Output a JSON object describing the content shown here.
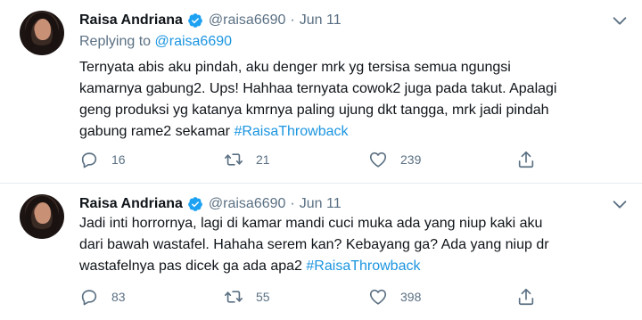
{
  "tweets": [
    {
      "name": "Raisa Andriana",
      "handle": "@raisa6690",
      "separator": "·",
      "time": "Jun 11",
      "replying_prefix": "Replying to",
      "replying_to": "@raisa6690",
      "text_lines": [
        "Ternyata abis aku pindah, aku denger mrk yg tersisa semua ngungsi",
        "kamarnya gabung2. Ups! Hahhaa ternyata cowok2 juga pada takut. Apalagi",
        "geng produksi yg katanya kmrnya paling ujung dkt tangga, mrk jadi pindah",
        "gabung rame2 sekamar"
      ],
      "hashtag": "#RaisaThrowback",
      "replies": "16",
      "retweets": "21",
      "likes": "239"
    },
    {
      "name": "Raisa Andriana",
      "handle": "@raisa6690",
      "separator": "·",
      "time": "Jun 11",
      "text_lines": [
        "Jadi inti horrornya, lagi di kamar mandi cuci muka ada yang niup kaki aku",
        "dari bawah wastafel. Hahaha serem kan? Kebayang ga? Ada yang niup dr",
        "wastafelnya pas dicek ga ada apa2"
      ],
      "hashtag": "#RaisaThrowback",
      "replies": "83",
      "retweets": "55",
      "likes": "398"
    }
  ],
  "icons": {
    "verified": "verified-badge-icon",
    "caret": "chevron-down-icon",
    "reply": "reply-bubble-icon",
    "retweet": "retweet-icon",
    "like": "heart-icon",
    "share": "share-icon"
  },
  "colors": {
    "link": "#1b95e0",
    "muted": "#5b7083",
    "text": "#0f1419",
    "verified": "#1da1f2"
  }
}
